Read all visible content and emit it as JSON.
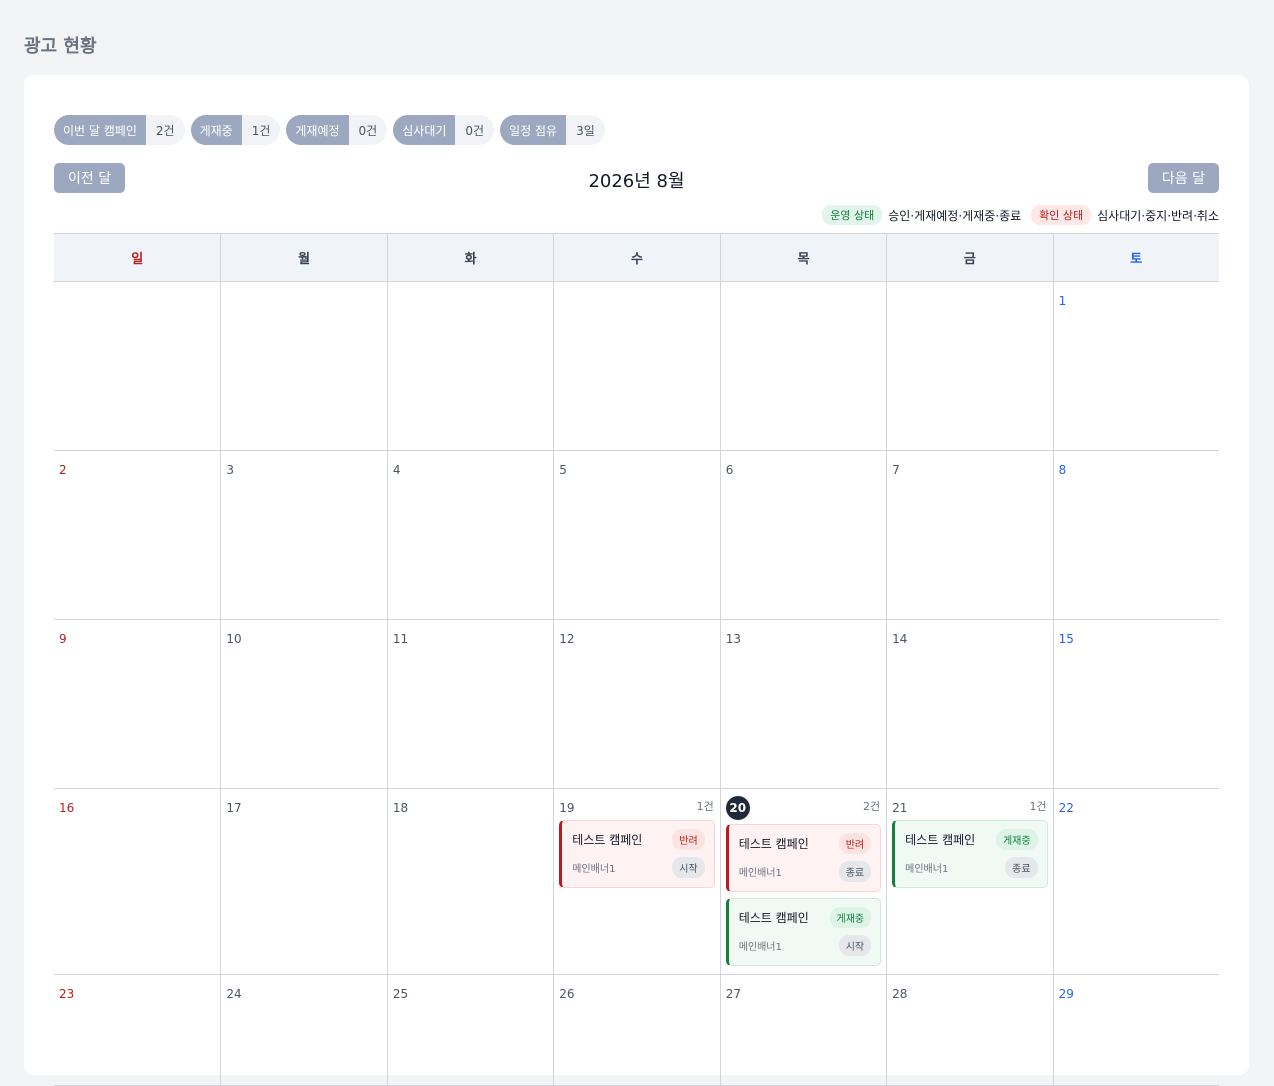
{
  "page": {
    "title": "광고 현황"
  },
  "stats": [
    {
      "label": "이번 달 캠페인",
      "value": "2건"
    },
    {
      "label": "게재중",
      "value": "1건"
    },
    {
      "label": "게재예정",
      "value": "0건"
    },
    {
      "label": "심사대기",
      "value": "0건"
    },
    {
      "label": "일정 점유",
      "value": "3일"
    }
  ],
  "nav": {
    "prev_label": "이전 달",
    "next_label": "다음 달",
    "month_title": "2026년 8월"
  },
  "legend": {
    "operating_label": "운영 상태",
    "operating_text": "승인·게재예정·게재중·종료",
    "check_label": "확인 상태",
    "check_text": "심사대기·중지·반려·취소"
  },
  "weekdays": [
    "일",
    "월",
    "화",
    "수",
    "목",
    "금",
    "토"
  ],
  "weeks": [
    [
      {
        "day": ""
      },
      {
        "day": ""
      },
      {
        "day": ""
      },
      {
        "day": ""
      },
      {
        "day": ""
      },
      {
        "day": ""
      },
      {
        "day": "1"
      }
    ],
    [
      {
        "day": "2"
      },
      {
        "day": "3"
      },
      {
        "day": "4"
      },
      {
        "day": "5"
      },
      {
        "day": "6"
      },
      {
        "day": "7"
      },
      {
        "day": "8"
      }
    ],
    [
      {
        "day": "9"
      },
      {
        "day": "10"
      },
      {
        "day": "11"
      },
      {
        "day": "12"
      },
      {
        "day": "13"
      },
      {
        "day": "14"
      },
      {
        "day": "15"
      }
    ],
    [
      {
        "day": "16"
      },
      {
        "day": "17"
      },
      {
        "day": "18"
      },
      {
        "day": "19",
        "count": "1건",
        "events": [
          {
            "name": "테스트 캠페인",
            "status": "반려",
            "tone": "red",
            "ad": "메인배너1",
            "phase": "시작"
          }
        ]
      },
      {
        "day": "20",
        "today": true,
        "count": "2건",
        "events": [
          {
            "name": "테스트 캠페인",
            "status": "반려",
            "tone": "red",
            "ad": "메인배너1",
            "phase": "종료"
          },
          {
            "name": "테스트 캠페인",
            "status": "게재중",
            "tone": "green",
            "ad": "메인배너1",
            "phase": "시작"
          }
        ]
      },
      {
        "day": "21",
        "count": "1건",
        "events": [
          {
            "name": "테스트 캠페인",
            "status": "게재중",
            "tone": "green",
            "ad": "메인배너1",
            "phase": "종료"
          }
        ]
      },
      {
        "day": "22"
      }
    ],
    [
      {
        "day": "23"
      },
      {
        "day": "24"
      },
      {
        "day": "25"
      },
      {
        "day": "26"
      },
      {
        "day": "27"
      },
      {
        "day": "28"
      },
      {
        "day": "29"
      }
    ]
  ]
}
